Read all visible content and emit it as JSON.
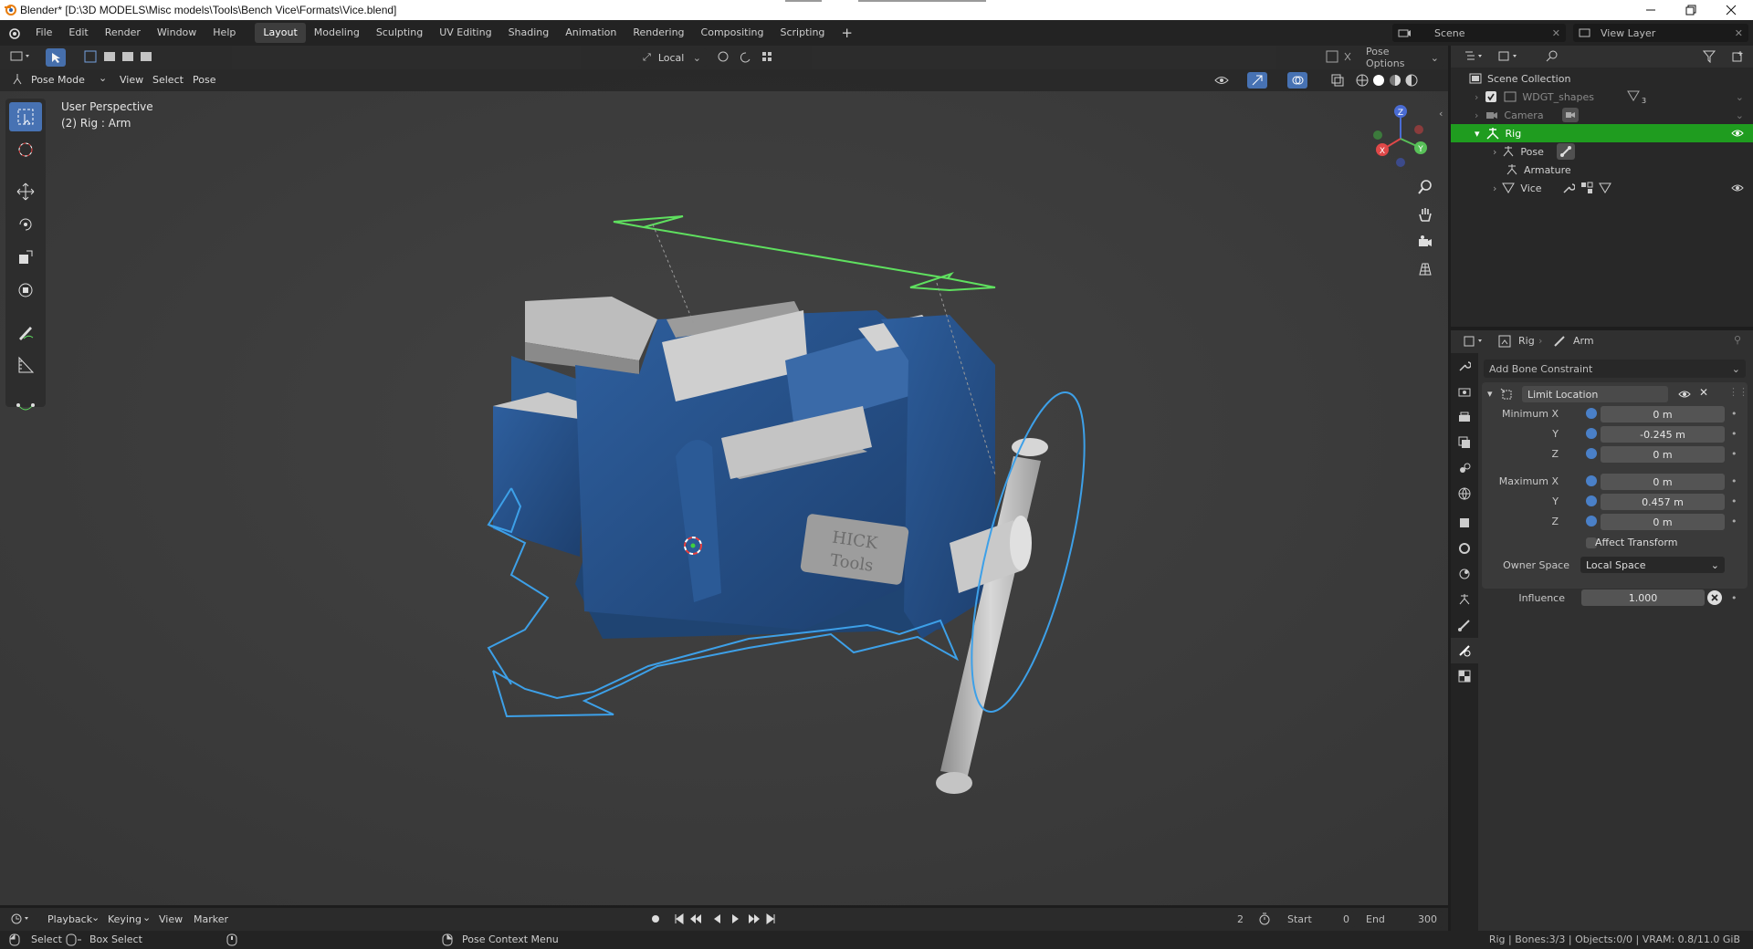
{
  "window": {
    "title": "Blender* [D:\\3D MODELS\\Misc models\\Tools\\Bench Vice\\Formats\\Vice.blend]"
  },
  "menus": [
    "File",
    "Edit",
    "Render",
    "Window",
    "Help"
  ],
  "workspaces": [
    "Layout",
    "Modeling",
    "Sculpting",
    "UV Editing",
    "Shading",
    "Animation",
    "Rendering",
    "Compositing",
    "Scripting"
  ],
  "active_workspace": "Layout",
  "scene": {
    "name": "Scene",
    "view_layer": "View Layer"
  },
  "viewport": {
    "mode": "Pose Mode",
    "menus": [
      "View",
      "Select",
      "Pose"
    ],
    "transform_orientation": "Local",
    "options_label": "Pose Options",
    "perspective": "User Perspective",
    "context": "(2) Rig : Arm",
    "gizmo": {
      "z": "Z",
      "x": "X",
      "y": "Y"
    },
    "nameplate": [
      "HICK",
      "Tools"
    ]
  },
  "outliner": {
    "rows": [
      {
        "label": "Scene Collection"
      },
      {
        "label": "WDGT_shapes",
        "badge": "3"
      },
      {
        "label": "Camera"
      },
      {
        "label": "Rig"
      },
      {
        "label": "Pose"
      },
      {
        "label": "Armature"
      },
      {
        "label": "Vice"
      }
    ]
  },
  "properties": {
    "breadcrumb_object": "Rig",
    "breadcrumb_bone": "Arm",
    "add_constraint": "Add Bone Constraint",
    "constraint_name": "Limit Location",
    "minimum": {
      "label": "Minimum X",
      "x": "0 m",
      "y": "-0.245 m",
      "z": "0 m"
    },
    "maximum": {
      "label": "Maximum X",
      "x": "0 m",
      "y": "0.457 m",
      "z": "0 m"
    },
    "y_label": "Y",
    "z_label": "Z",
    "affect_transform": "Affect Transform",
    "owner_space_label": "Owner Space",
    "owner_space_value": "Local Space",
    "influence_label": "Influence",
    "influence_value": "1.000"
  },
  "timeline": {
    "menus": [
      "Playback",
      "Keying",
      "View",
      "Marker"
    ],
    "current_frame": "2",
    "start_label": "Start",
    "start_value": "0",
    "end_label": "End",
    "end_value": "300"
  },
  "statusbar": {
    "select": "Select",
    "box_select": "Box Select",
    "context_menu": "Pose Context Menu",
    "stats": "Rig | Bones:3/3 | Objects:0/0 | VRAM: 0.8/11.0 GiB"
  }
}
